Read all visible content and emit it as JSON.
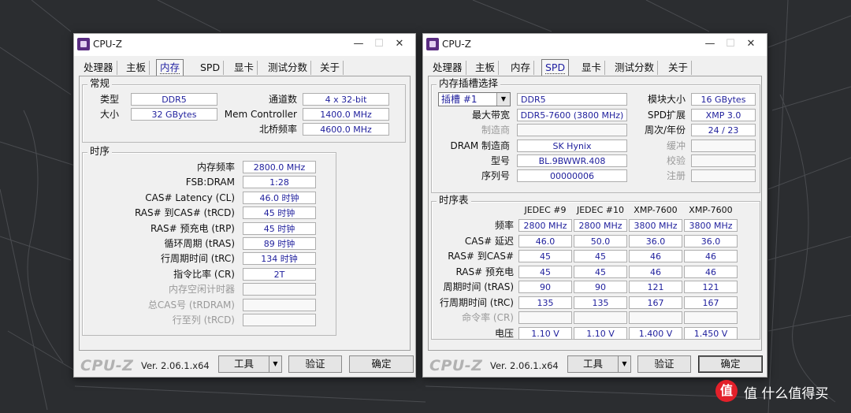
{
  "watermark": {
    "text": "值 什么值得买",
    "badge": "值"
  },
  "left": {
    "title": "CPU-Z",
    "tabs": [
      "处理器",
      "主板",
      "内存",
      "SPD",
      "显卡",
      "测试分数",
      "关于"
    ],
    "active_tab": "内存",
    "general": {
      "legend": "常规",
      "type_label": "类型",
      "type_value": "DDR5",
      "size_label": "大小",
      "size_value": "32 GBytes",
      "channels_label": "通道数",
      "channels_value": "4 x 32-bit",
      "mc_label": "Mem Controller",
      "mc_value": "1400.0 MHz",
      "nb_label": "北桥频率",
      "nb_value": "4600.0 MHz"
    },
    "timings": {
      "legend": "时序",
      "rows": [
        {
          "label": "内存频率",
          "value": "2800.0 MHz"
        },
        {
          "label": "FSB:DRAM",
          "value": "1:28"
        },
        {
          "label": "CAS# Latency (CL)",
          "value": "46.0 时钟"
        },
        {
          "label": "RAS# 到CAS# (tRCD)",
          "value": "45 时钟"
        },
        {
          "label": "RAS# 预充电 (tRP)",
          "value": "45 时钟"
        },
        {
          "label": "循环周期 (tRAS)",
          "value": "89 时钟"
        },
        {
          "label": "行周期时间 (tRC)",
          "value": "134 时钟"
        },
        {
          "label": "指令比率 (CR)",
          "value": "2T"
        },
        {
          "label": "内存空闲计时器",
          "value": ""
        },
        {
          "label": "总CAS号 (tRDRAM)",
          "value": ""
        },
        {
          "label": "行至列 (tRCD)",
          "value": ""
        }
      ]
    },
    "bottom": {
      "brand": "CPU-Z",
      "version": "Ver. 2.06.1.x64",
      "tools": "工具",
      "validate": "验证",
      "ok": "确定"
    }
  },
  "right": {
    "title": "CPU-Z",
    "tabs": [
      "处理器",
      "主板",
      "内存",
      "SPD",
      "显卡",
      "测试分数",
      "关于"
    ],
    "active_tab": "SPD",
    "slot": {
      "legend": "内存插槽选择",
      "slot_value": "插槽 #1",
      "module_type": "DDR5",
      "max_bw_label": "最大带宽",
      "max_bw_value": "DDR5-7600 (3800 MHz)",
      "manufacturer_label": "制造商",
      "manufacturer_value": "",
      "dram_mfr_label": "DRAM 制造商",
      "dram_mfr_value": "SK Hynix",
      "part_label": "型号",
      "part_value": "BL.9BWWR.408",
      "serial_label": "序列号",
      "serial_value": "00000006",
      "module_size_label": "模块大小",
      "module_size_value": "16 GBytes",
      "spd_ext_label": "SPD扩展",
      "spd_ext_value": "XMP 3.0",
      "week_year_label": "周次/年份",
      "week_year_value": "24 / 23",
      "buffered_label": "缓冲",
      "buffered_value": "",
      "correction_label": "校验",
      "correction_value": "",
      "registered_label": "注册",
      "registered_value": ""
    },
    "timing_table": {
      "legend": "时序表",
      "headers": [
        "JEDEC #9",
        "JEDEC #10",
        "XMP-7600",
        "XMP-7600"
      ],
      "rows": [
        {
          "label": "频率",
          "values": [
            "2800 MHz",
            "2800 MHz",
            "3800 MHz",
            "3800 MHz"
          ]
        },
        {
          "label": "CAS# 延迟",
          "values": [
            "46.0",
            "50.0",
            "36.0",
            "36.0"
          ]
        },
        {
          "label": "RAS# 到CAS#",
          "values": [
            "45",
            "45",
            "46",
            "46"
          ]
        },
        {
          "label": "RAS# 预充电",
          "values": [
            "45",
            "45",
            "46",
            "46"
          ]
        },
        {
          "label": "周期时间 (tRAS)",
          "values": [
            "90",
            "90",
            "121",
            "121"
          ]
        },
        {
          "label": "行周期时间 (tRC)",
          "values": [
            "135",
            "135",
            "167",
            "167"
          ]
        },
        {
          "label": "命令率 (CR)",
          "values": [
            "",
            "",
            "",
            ""
          ]
        },
        {
          "label": "电压",
          "values": [
            "1.10 V",
            "1.10 V",
            "1.400 V",
            "1.450 V"
          ]
        }
      ]
    },
    "bottom": {
      "brand": "CPU-Z",
      "version": "Ver. 2.06.1.x64",
      "tools": "工具",
      "validate": "验证",
      "ok": "确定"
    }
  }
}
